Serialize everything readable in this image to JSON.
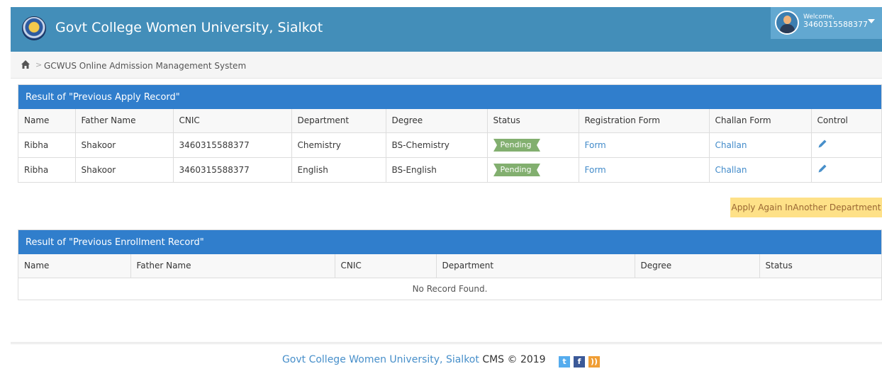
{
  "header": {
    "brand": "Govt College Women University, Sialkot",
    "welcome": "Welcome,",
    "user_cnic": "3460315588377"
  },
  "breadcrumb": {
    "text": "GCWUS Online Admission Management System"
  },
  "apply_panel": {
    "title": "Result of \"Previous Apply Record\"",
    "columns": [
      "Name",
      "Father Name",
      "CNIC",
      "Department",
      "Degree",
      "Status",
      "Registration Form",
      "Challan Form",
      "Control"
    ],
    "rows": [
      {
        "name": "Ribha",
        "father": "Shakoor",
        "cnic": "3460315588377",
        "department": "Chemistry",
        "degree": "BS-Chemistry",
        "status": "Pending",
        "form": "Form",
        "challan": "Challan"
      },
      {
        "name": "Ribha",
        "father": "Shakoor",
        "cnic": "3460315588377",
        "department": "English",
        "degree": "BS-English",
        "status": "Pending",
        "form": "Form",
        "challan": "Challan"
      }
    ]
  },
  "apply_again_label": "Apply Again InAnother Department",
  "enroll_panel": {
    "title": "Result of \"Previous Enrollment Record\"",
    "columns": [
      "Name",
      "Father Name",
      "CNIC",
      "Department",
      "Degree",
      "Status"
    ],
    "empty_text": "No Record Found."
  },
  "footer": {
    "brand": "Govt College Women University, Sialkot",
    "cms": "CMS © 2019"
  },
  "colors": {
    "header": "#438eb9",
    "panel_header": "#307ecc",
    "status_pending": "#82af6f",
    "apply_button": "#fee188"
  },
  "icons": [
    "university-logo-icon",
    "user-avatar-icon",
    "home-icon",
    "pencil-icon",
    "twitter-icon",
    "facebook-icon",
    "rss-icon"
  ]
}
